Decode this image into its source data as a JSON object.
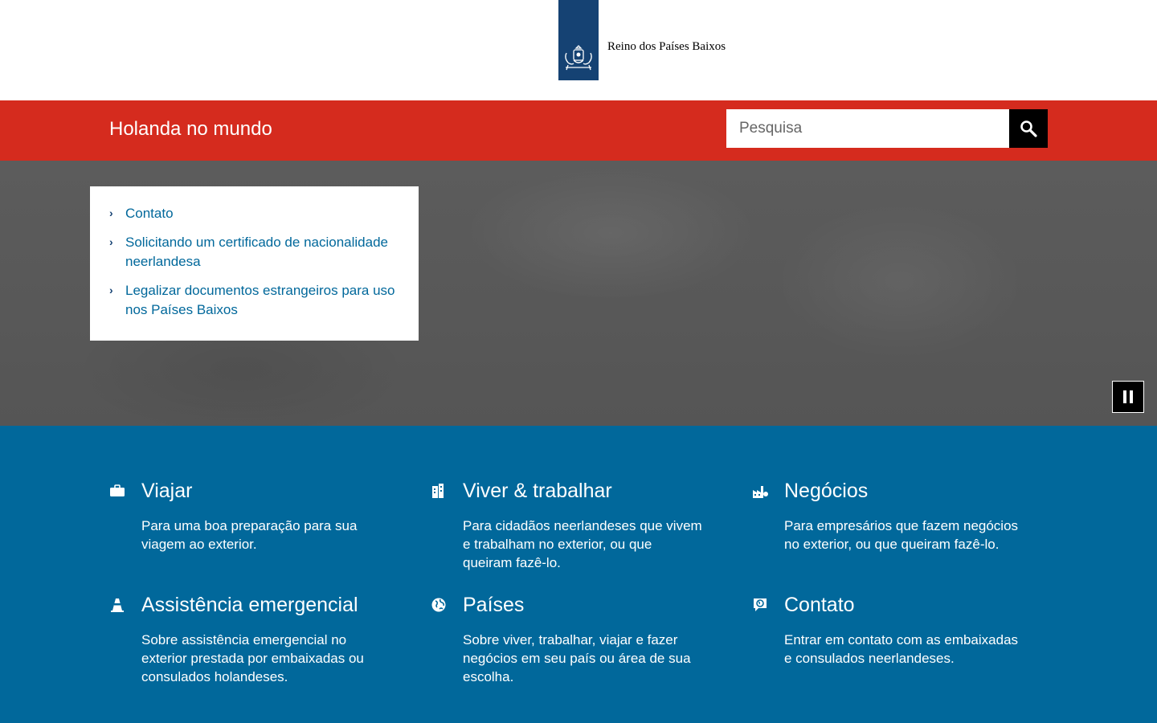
{
  "logo": {
    "text": "Reino dos Países Baixos"
  },
  "header": {
    "site_title": "Holanda no mundo",
    "search_placeholder": "Pesquisa"
  },
  "hero": {
    "links": [
      {
        "label": "Contato"
      },
      {
        "label": "Solicitando um certificado de nacionalidade neerlandesa"
      },
      {
        "label": "Legalizar documentos estrangeiros para uso nos Países Baixos"
      }
    ]
  },
  "tiles": [
    {
      "icon": "briefcase-icon",
      "title": "Viajar",
      "desc": "Para uma boa preparação para sua viagem ao exterior."
    },
    {
      "icon": "buildings-icon",
      "title": "Viver & trabalhar",
      "desc": "Para cidadãos neerlandeses que vivem e trabalham no exterior, ou que queiram fazê-lo."
    },
    {
      "icon": "factory-icon",
      "title": "Negócios",
      "desc": "Para empresários que fazem negócios no exterior, ou que queiram fazê-lo."
    },
    {
      "icon": "traffic-cone-icon",
      "title": "Assistência emergencial",
      "desc": "Sobre assistência emergencial no exterior prestada por embaixadas ou consulados holandeses."
    },
    {
      "icon": "globe-icon",
      "title": "Países",
      "desc": "Sobre viver, trabalhar, viajar e fazer negócios em seu país ou área de sua escolha."
    },
    {
      "icon": "chat-globe-icon",
      "title": "Contato",
      "desc": "Entrar em contato com as embaixadas e consulados neerlandeses."
    }
  ],
  "colors": {
    "header_red": "#d52b1e",
    "logo_blue": "#154273",
    "tiles_blue": "#01689b"
  }
}
